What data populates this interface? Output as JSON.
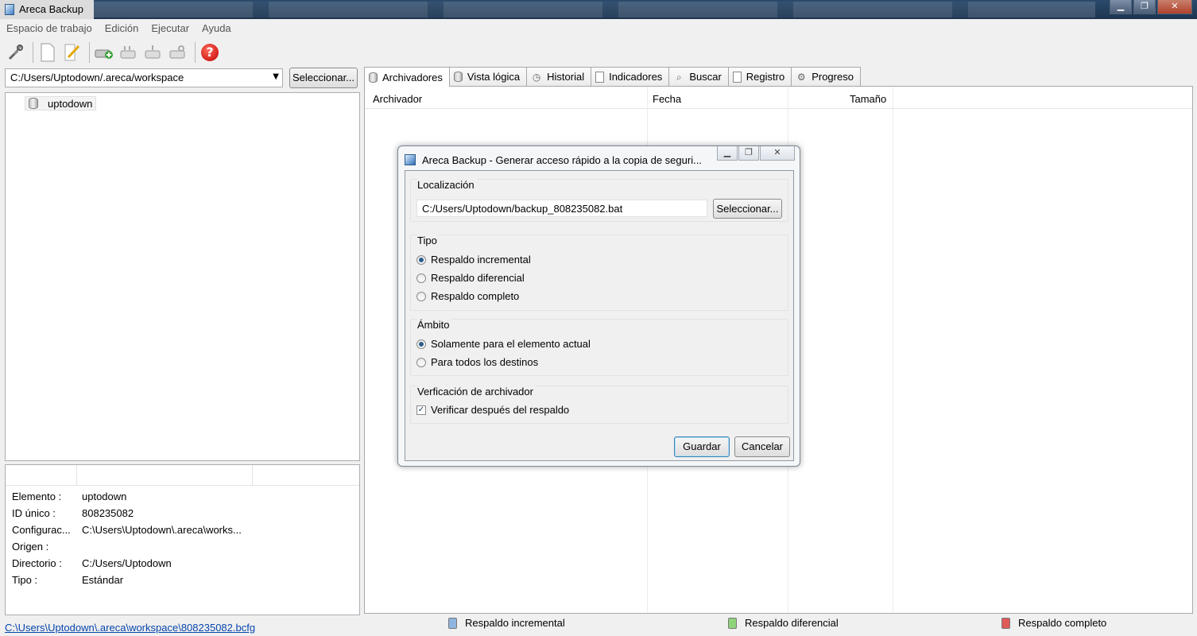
{
  "window": {
    "title": "Areca Backup",
    "controls": {
      "minimize": "▁",
      "maximize": "❐",
      "close": "✕"
    }
  },
  "menu": [
    "Espacio de trabajo",
    "Edición",
    "Ejecutar",
    "Ayuda"
  ],
  "toolbar": {
    "icons": [
      "tools-icon",
      "new-document-icon",
      "edit-icon",
      "add-target-icon",
      "backup-icon",
      "merge-icon",
      "check-icon",
      "help-icon"
    ]
  },
  "workspace": {
    "path": "C:/Users/Uptodown/.areca/workspace",
    "select_label": "Seleccionar..."
  },
  "tree": {
    "items": [
      "uptodown"
    ]
  },
  "properties": {
    "rows": [
      {
        "key": "Elemento :",
        "value": "uptodown"
      },
      {
        "key": "ID único :",
        "value": "808235082"
      },
      {
        "key": "Configurac...",
        "value": "C:\\Users\\Uptodown\\.areca\\works..."
      },
      {
        "key": "Origen :",
        "value": ""
      },
      {
        "key": "Directorio :",
        "value": "C:/Users/Uptodown"
      },
      {
        "key": "Tipo :",
        "value": "Estándar"
      }
    ]
  },
  "footer_link": "C:\\Users\\Uptodown\\.areca\\workspace\\808235082.bcfg",
  "tabs": [
    {
      "label": "Archivadores"
    },
    {
      "label": "Vista lógica"
    },
    {
      "label": "Historial"
    },
    {
      "label": "Indicadores"
    },
    {
      "label": "Buscar"
    },
    {
      "label": "Registro"
    },
    {
      "label": "Progreso"
    }
  ],
  "grid": {
    "columns": [
      "Archivador",
      "Fecha",
      "Tamaño"
    ]
  },
  "status": {
    "incremental": "Respaldo incremental",
    "differential": "Respaldo diferencial",
    "full": "Respaldo completo",
    "colors": {
      "incremental": "#8fb4e0",
      "differential": "#8fd47a",
      "full": "#e05a5a"
    }
  },
  "dialog": {
    "title": "Areca Backup - Generar acceso rápido a la copia de seguri...",
    "location": {
      "label": "Localización",
      "value": "C:/Users/Uptodown/backup_808235082.bat",
      "select_label": "Seleccionar..."
    },
    "type": {
      "label": "Tipo",
      "options": [
        "Respaldo incremental",
        "Respaldo diferencial",
        "Respaldo completo"
      ],
      "selected": 0
    },
    "scope": {
      "label": "Ámbito",
      "options": [
        "Solamente para el elemento actual",
        "Para todos los destinos"
      ],
      "selected": 0
    },
    "verify": {
      "label": "Verficación de archivador",
      "checkbox_label": "Verificar después del respaldo",
      "checked": true
    },
    "save_label": "Guardar",
    "cancel_label": "Cancelar"
  }
}
